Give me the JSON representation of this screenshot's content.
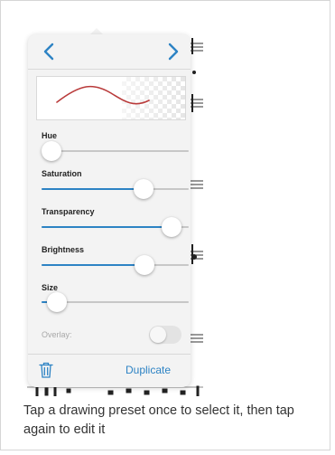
{
  "popover": {
    "preview": {
      "stroke_color": "#b93a3a"
    },
    "sliders": [
      {
        "label": "Hue",
        "value": 0.0
      },
      {
        "label": "Saturation",
        "value": 0.72
      },
      {
        "label": "Transparency",
        "value": 0.94
      },
      {
        "label": "Brightness",
        "value": 0.73
      },
      {
        "label": "Size",
        "value": 0.04
      }
    ],
    "overlay": {
      "label": "Overlay:",
      "enabled": false
    },
    "footer": {
      "duplicate_label": "Duplicate"
    }
  },
  "caption": "Tap a drawing preset once to select it, then tap again to edit it",
  "colors": {
    "accent": "#2d83c4",
    "popover_bg": "#f3f3f3"
  }
}
